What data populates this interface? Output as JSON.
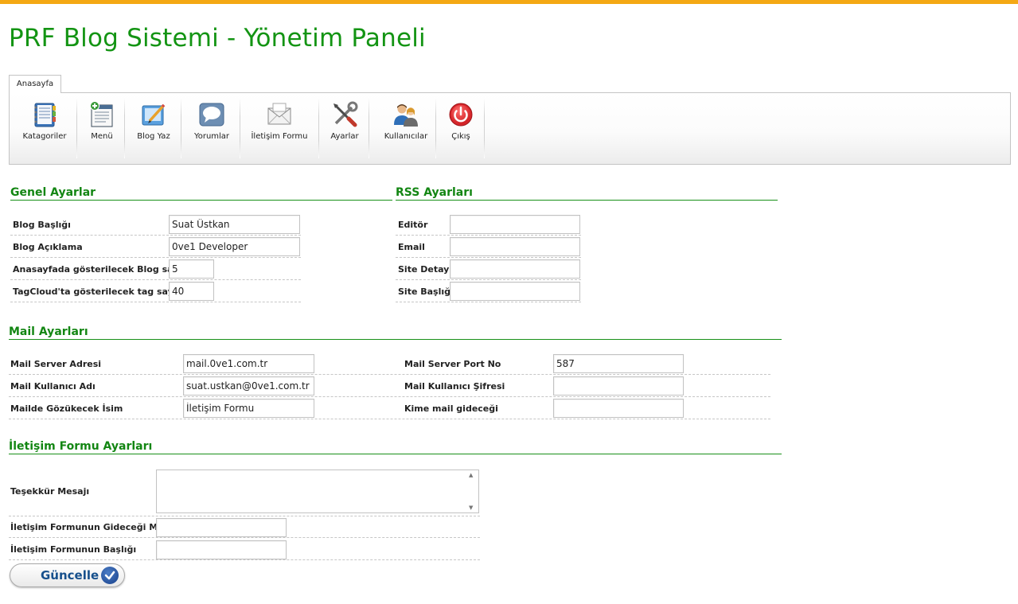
{
  "page": {
    "title": "PRF Blog Sistemi - Yönetim Paneli"
  },
  "tabs": [
    {
      "label": "Anasayfa"
    }
  ],
  "toolbar": [
    {
      "label": "Katagoriler",
      "icon": "categories-icon"
    },
    {
      "label": "Menü",
      "icon": "menu-icon"
    },
    {
      "label": "Blog Yaz",
      "icon": "blog-write-icon"
    },
    {
      "label": "Yorumlar",
      "icon": "comments-icon"
    },
    {
      "label": "İletişim Formu",
      "icon": "contact-form-icon"
    },
    {
      "label": "Ayarlar",
      "icon": "settings-icon"
    },
    {
      "label": "Kullanıcılar",
      "icon": "users-icon"
    },
    {
      "label": "Çıkış",
      "icon": "power-icon"
    }
  ],
  "general": {
    "title": "Genel Ayarlar",
    "blog_title": {
      "label": "Blog Başlığı",
      "value": "Suat Üstkan"
    },
    "blog_desc": {
      "label": "Blog Açıklama",
      "value": "0ve1 Developer"
    },
    "home_count": {
      "label": "Anasayfada gösterilecek Blog sayısı",
      "value": "5"
    },
    "tag_count": {
      "label": "TagCloud'ta gösterilecek tag sayısı",
      "value": "40"
    }
  },
  "rss": {
    "title": "RSS Ayarları",
    "editor": {
      "label": "Editör",
      "value": ""
    },
    "email": {
      "label": "Email",
      "value": ""
    },
    "site_detail": {
      "label": "Site Detayı",
      "value": ""
    },
    "site_title": {
      "label": "Site Başlığı",
      "value": ""
    }
  },
  "mail": {
    "title": "Mail Ayarları",
    "server": {
      "label": "Mail Server Adresi",
      "value": "mail.0ve1.com.tr"
    },
    "user": {
      "label": "Mail Kullanıcı Adı",
      "value": "suat.ustkan@0ve1.com.tr"
    },
    "display_name": {
      "label": "Mailde Gözükecek İsim",
      "value": "İletişim Formu"
    },
    "port": {
      "label": "Mail Server Port No",
      "value": "587"
    },
    "password": {
      "label": "Mail Kullanıcı Şifresi",
      "value": ""
    },
    "to": {
      "label": "Kime mail gideceği",
      "value": ""
    }
  },
  "contact": {
    "title": "İletişim Formu Ayarları",
    "thanks": {
      "label": "Teşekkür Mesajı",
      "value": ""
    },
    "target_mail": {
      "label": "İletişim Formunun Gideceği Mail",
      "value": ""
    },
    "form_title": {
      "label": "İletişim Formunun Başlığı",
      "value": ""
    }
  },
  "buttons": {
    "update": "Güncelle"
  },
  "colors": {
    "accent_bar": "#f4a814",
    "title_green": "#139413",
    "button_blue": "#17508c"
  }
}
